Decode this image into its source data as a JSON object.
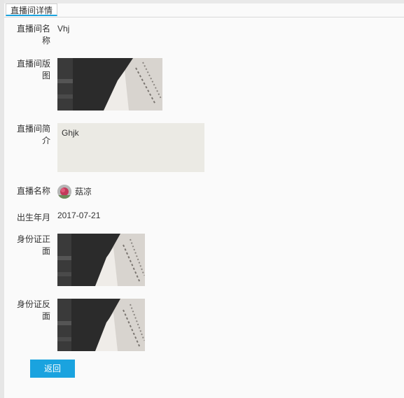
{
  "tab": {
    "label": "直播间详情"
  },
  "room_name": {
    "label_line1": "直播间名",
    "label_line2": "称",
    "value": "Vhj"
  },
  "room_cover": {
    "label_line1": "直播间版",
    "label_line2": "图"
  },
  "room_intro": {
    "label_line1": "直播间简",
    "label_line2": "介",
    "value": "Ghjk"
  },
  "host": {
    "label": "直播名称",
    "name": "菇凉"
  },
  "birth": {
    "label": "出生年月",
    "value": "2017-07-21"
  },
  "id_front": {
    "label_line1": "身份证正",
    "label_line2": "面"
  },
  "id_back": {
    "label_line1": "身份证反",
    "label_line2": "面"
  },
  "actions": {
    "back_label": "返回"
  },
  "colors": {
    "accent": "#1aa3df",
    "intro_bg": "#ebeae4"
  }
}
